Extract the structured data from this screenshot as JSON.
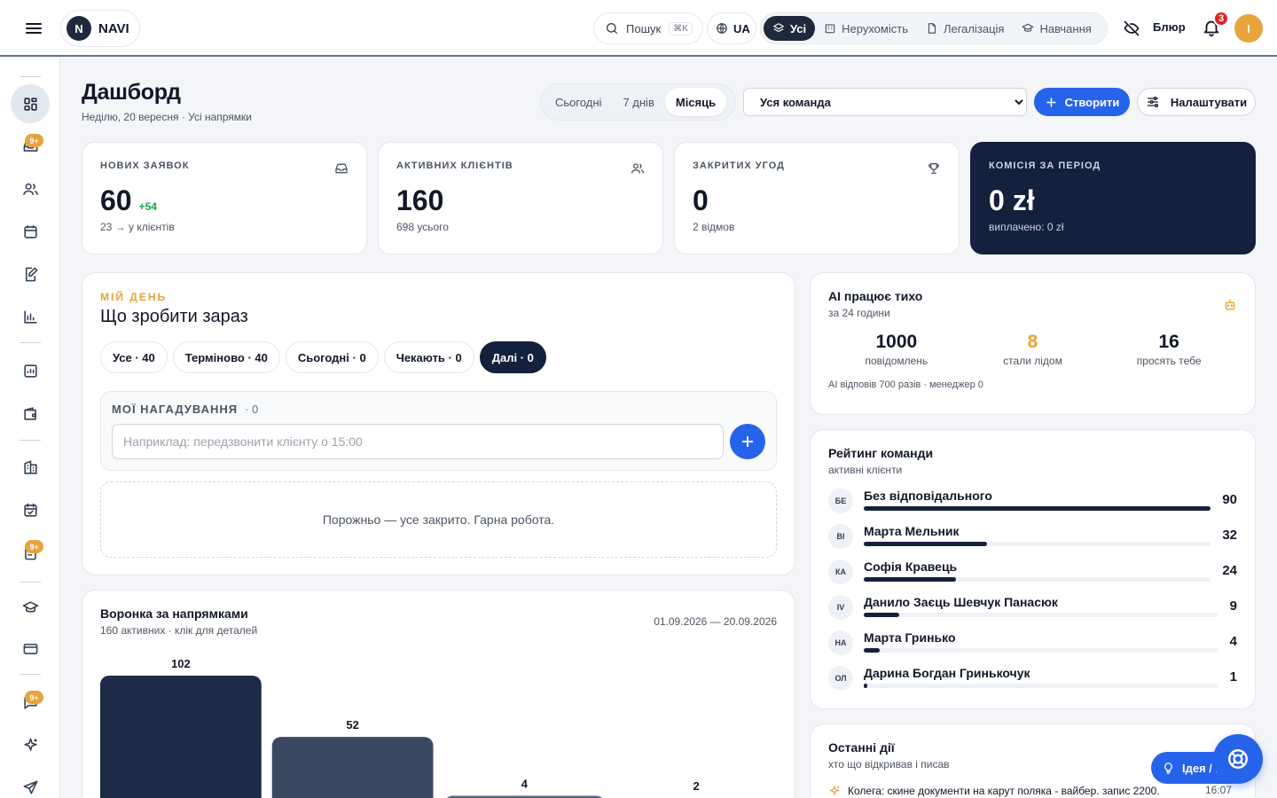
{
  "brand": {
    "mark": "N",
    "name": "NAVI"
  },
  "topbar": {
    "search_label": "Пошук",
    "search_shortcut": "⌘K",
    "lang": "UA",
    "segments": [
      {
        "label": "Усі",
        "active": true,
        "icon": "layers-icon"
      },
      {
        "label": "Нерухомість",
        "active": false,
        "icon": "building-icon"
      },
      {
        "label": "Легалізація",
        "active": false,
        "icon": "document-icon"
      },
      {
        "label": "Навчання",
        "active": false,
        "icon": "graduation-cap-icon"
      }
    ],
    "blur_label": "Блюр",
    "notifications_count": "3",
    "avatar_initial": "I"
  },
  "sidebar": {
    "items": [
      {
        "icon": "dashboard-icon",
        "active": true
      },
      {
        "icon": "inbox-icon",
        "badge": "9+"
      },
      {
        "icon": "users-icon"
      },
      {
        "icon": "calendar-icon"
      },
      {
        "icon": "edit-document-icon"
      },
      {
        "icon": "bar-chart-icon"
      },
      {
        "icon": "analytics-icon"
      },
      {
        "icon": "wallet-icon"
      },
      {
        "icon": "buildings-icon"
      },
      {
        "icon": "calendar-check-icon"
      },
      {
        "icon": "clipboard-icon",
        "badge": "9+"
      },
      {
        "icon": "graduation-cap-icon"
      },
      {
        "icon": "credit-card-icon"
      },
      {
        "icon": "chat-icon",
        "badge": "9+"
      },
      {
        "icon": "sparkles-icon"
      },
      {
        "icon": "send-icon"
      }
    ]
  },
  "header": {
    "title": "Дашборд",
    "subtitle": "Неділю, 20 вересня · Усі напрямки",
    "periods": [
      {
        "label": "Сьогодні",
        "active": false
      },
      {
        "label": "7 днів",
        "active": false
      },
      {
        "label": "Місяць",
        "active": true
      }
    ],
    "team_select": "Уся команда",
    "create_label": "Створити",
    "settings_label": "Налаштувати"
  },
  "stats": [
    {
      "label": "НОВИХ ЗАЯВОК",
      "value": "60",
      "delta": "+54",
      "sub": "23 → у клієнтів",
      "icon": "inbox-icon"
    },
    {
      "label": "АКТИВНИХ КЛІЄНТІВ",
      "value": "160",
      "sub": "698 усього",
      "icon": "users-icon"
    },
    {
      "label": "ЗАКРИТИХ УГОД",
      "value": "0",
      "sub": "2 відмов",
      "icon": "trophy-icon"
    },
    {
      "label": "КОМІСІЯ ЗА ПЕРІОД",
      "value": "0 zł",
      "sub": "виплачено: 0 zł"
    }
  ],
  "todo": {
    "eyebrow": "МІЙ ДЕНЬ",
    "title": "Що зробити зараз",
    "filters": [
      {
        "label": "Усе · 40",
        "active": false
      },
      {
        "label": "Терміново · 40",
        "active": false
      },
      {
        "label": "Сьогодні · 0",
        "active": false
      },
      {
        "label": "Чекають · 0",
        "active": false
      },
      {
        "label": "Далі · 0",
        "active": true
      }
    ],
    "reminders_title": "МОЇ НАГАДУВАННЯ",
    "reminders_count": "· 0",
    "reminder_placeholder": "Наприклад: передзвонити клієнту о 15:00",
    "empty_text": "Порожньо — усе закрито. Гарна робота."
  },
  "funnel": {
    "title": "Воронка за напрямками",
    "subtitle": "160 активних · клік для деталей",
    "range": "01.09.2026 — 20.09.2026"
  },
  "chart_data": {
    "type": "bar",
    "categories": [
      "",
      "",
      "",
      ""
    ],
    "values": [
      102,
      52,
      4,
      2
    ],
    "colors": [
      "#1e2b47",
      "#3b4862",
      "#5a6579",
      "#8b93a2"
    ],
    "title": "Воронка за напрямками",
    "xlabel": "",
    "ylabel": "",
    "ylim": [
      0,
      102
    ]
  },
  "ai": {
    "title": "AI працює тихо",
    "subtitle": "за 24 години",
    "stats": [
      {
        "value": "1000",
        "label": "повідомлень"
      },
      {
        "value": "8",
        "label": "стали лідом",
        "accent": true
      },
      {
        "value": "16",
        "label": "просять тебе"
      }
    ],
    "footer": "AI відповів 700 разів · менеджер 0"
  },
  "rating": {
    "title": "Рейтинг команди",
    "subtitle": "активні клієнти",
    "max": 90,
    "rows": [
      {
        "initials": "БЕ",
        "name": "Без відповідального",
        "value": 90
      },
      {
        "initials": "ВІ",
        "name": "Марта Мельник",
        "value": 32
      },
      {
        "initials": "КА",
        "name": "Софія Кравець",
        "value": 24
      },
      {
        "initials": "IV",
        "name": "Данило Заєць Шевчук Панасюк",
        "value": 9
      },
      {
        "initials": "НА",
        "name": "Марта Гринько",
        "value": 4
      },
      {
        "initials": "ОЛ",
        "name": "Дарина Богдан Гринькочук",
        "value": 1
      }
    ]
  },
  "recent": {
    "title": "Останні дії",
    "subtitle": "хто що відкривав і писав",
    "items": [
      {
        "text": "Колега: скине документи на карут поляка - вайбер. запис 2200.",
        "time": "16:07"
      }
    ]
  },
  "floating": {
    "idea_label": "Ідея / ..."
  }
}
